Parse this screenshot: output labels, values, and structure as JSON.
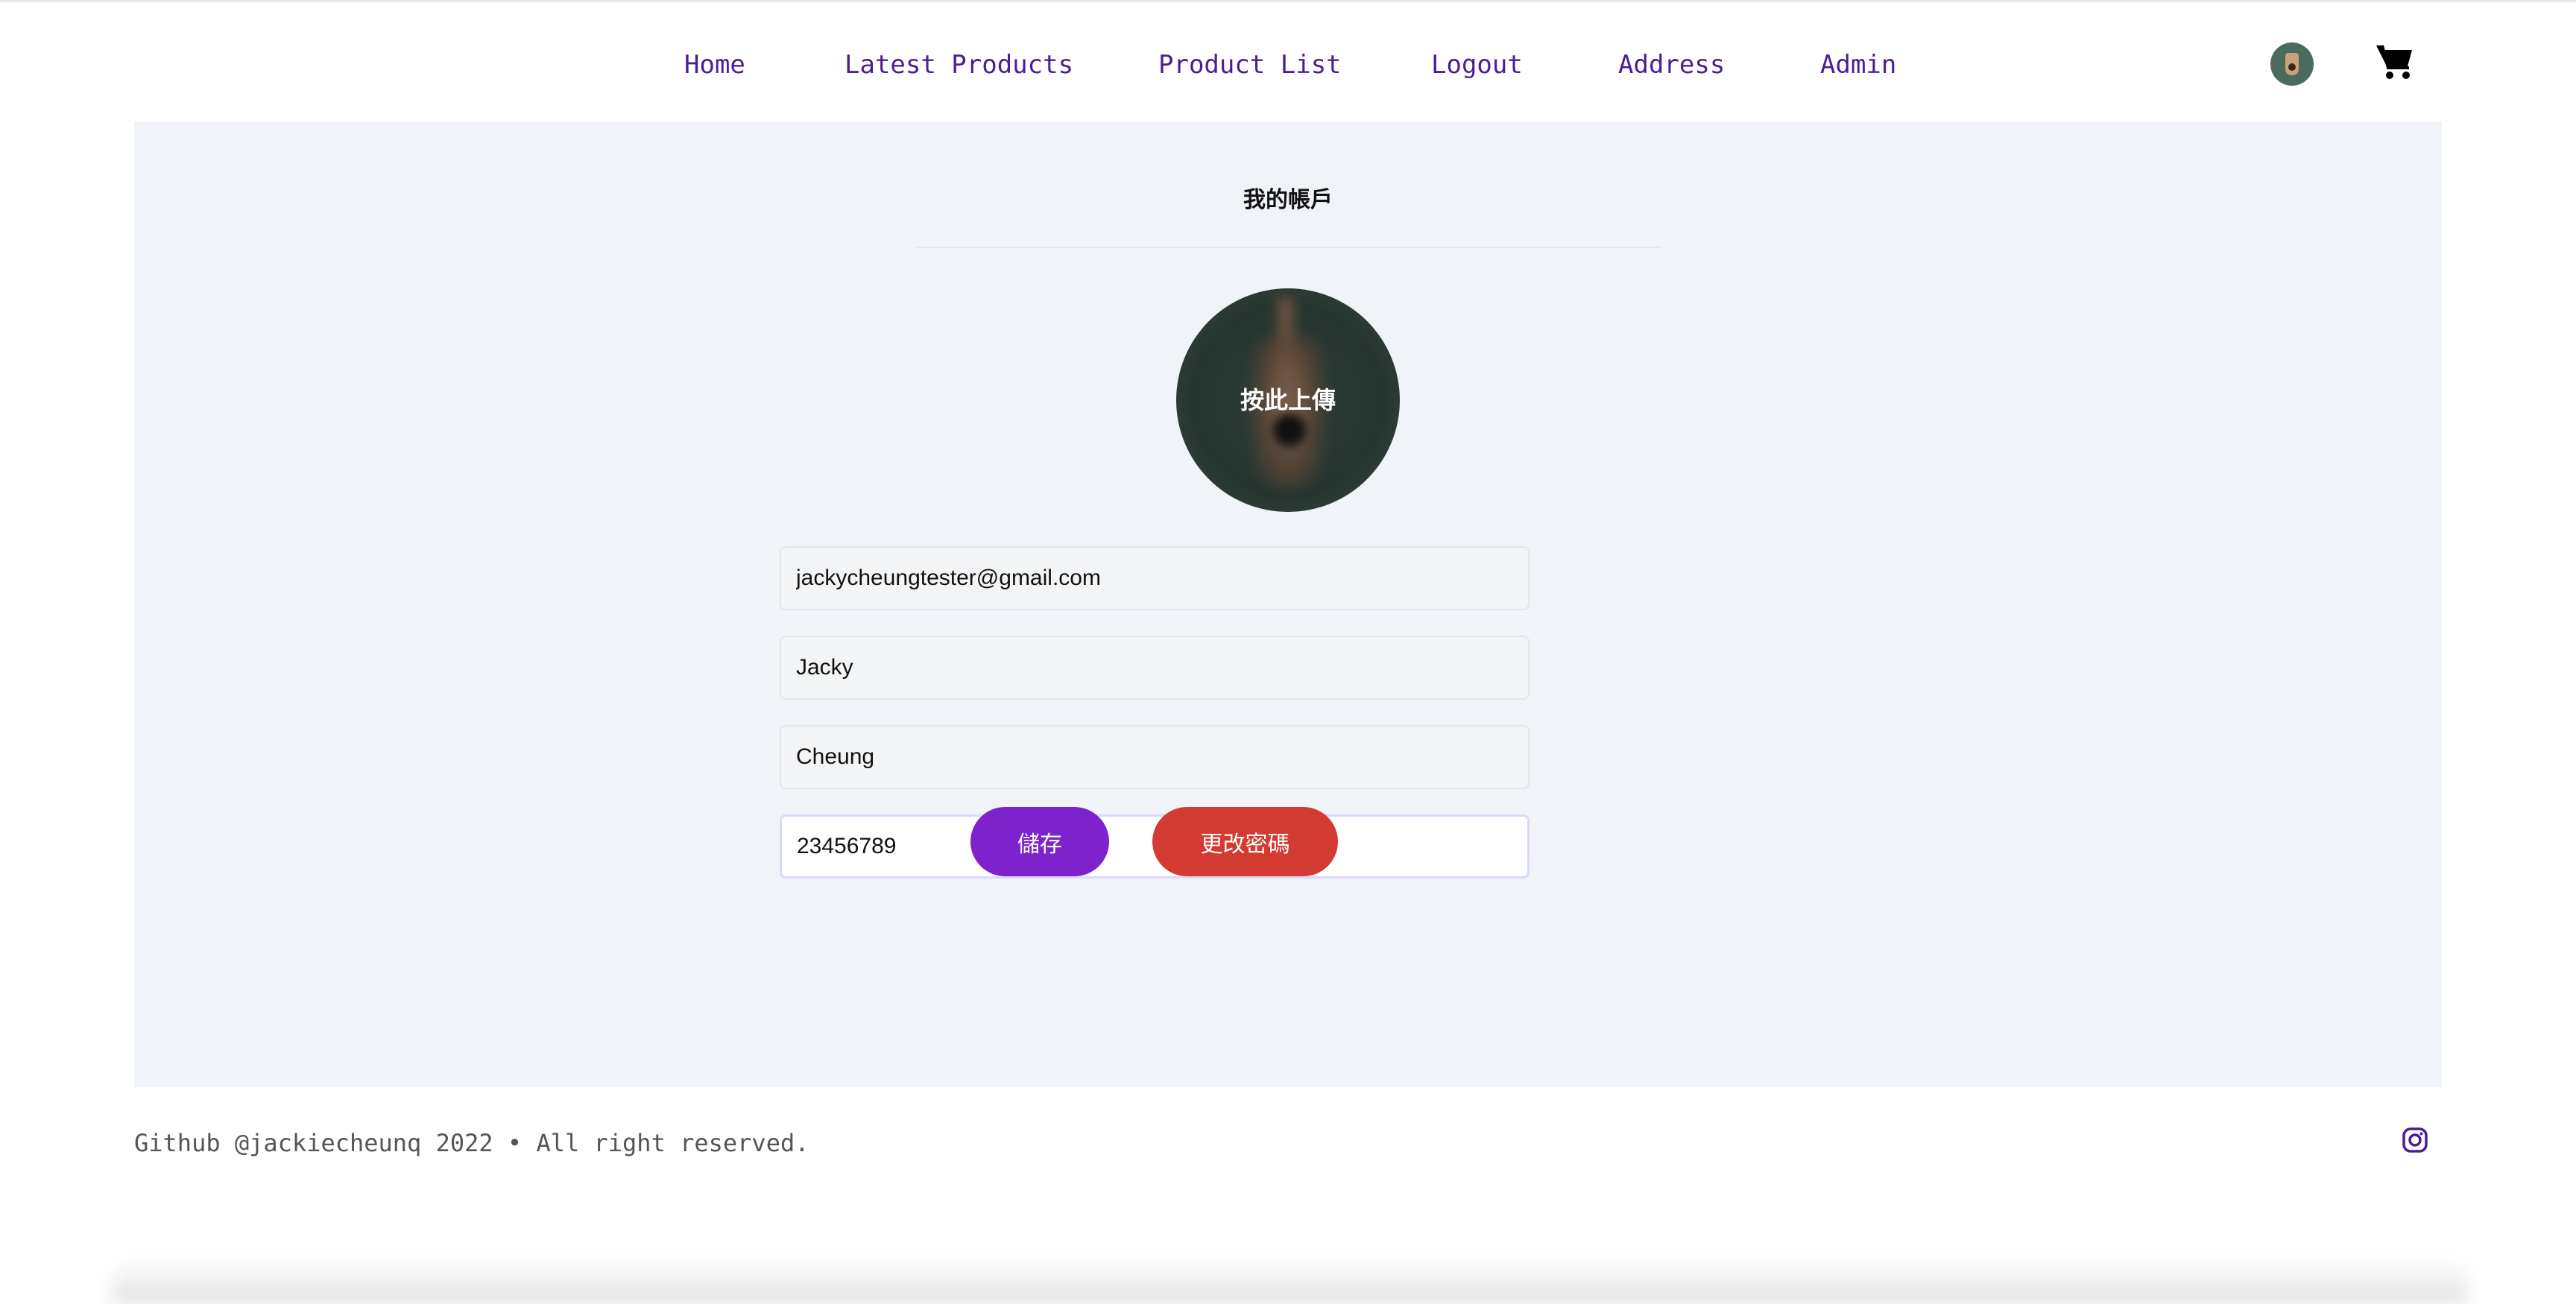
{
  "nav": {
    "links": [
      "Home",
      "Latest Products",
      "Product List",
      "Logout",
      "Address",
      "Admin"
    ],
    "avatar_icon": "user-avatar-icon",
    "cart_icon": "shopping-cart-icon"
  },
  "account": {
    "title": "我的帳戶",
    "upload_label": "按此上傳",
    "fields": {
      "email": "jackycheungtester@gmail.com",
      "first_name": "Jacky",
      "last_name": "Cheung",
      "phone": "23456789"
    },
    "save_label": "儲存",
    "change_password_label": "更改密碼"
  },
  "footer": {
    "text": "Github @jackiecheunq 2022 • All right reserved.",
    "social_icon": "instagram-icon"
  },
  "colors": {
    "nav_link": "#4c1d95",
    "panel_bg": "#f0f3f8",
    "save_button": "#7e22ce",
    "change_password_button": "#d33a31",
    "active_field_border": "#ddd6fe"
  }
}
